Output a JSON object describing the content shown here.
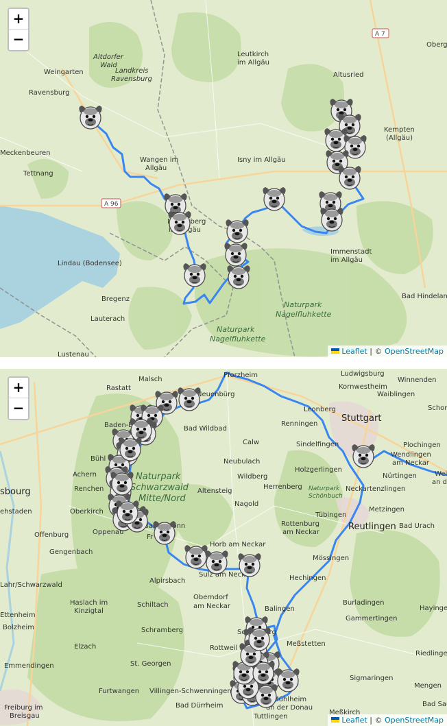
{
  "zoom": {
    "in": "+",
    "out": "−"
  },
  "attribution": {
    "leaflet": "Leaflet",
    "separator": " | © ",
    "osm": "OpenStreetMap"
  },
  "colors": {
    "route": "#3a86f0",
    "water": "#aad3df",
    "forest": "#c3dca6",
    "border": "#8a8a8a"
  },
  "map1": {
    "places": {
      "oberg": "Oberg",
      "altdorfer": "Altdorfer",
      "wald": "Wald",
      "landkreis": "Landkreis",
      "landkreis2": "Ravensburg",
      "weingarten": "Weingarten",
      "leutkirch": "Leutkirch",
      "leutkirch2": "im Allgäu",
      "altusried": "Altusried",
      "ravensburg": "Ravensburg",
      "kempten": "Kempten",
      "kempten2": "(Allgäu)",
      "meckenbeuren": "Meckenbeuren",
      "wangen": "Wangen im",
      "wangen2": "Allgäu",
      "isny": "Isny im Allgäu",
      "tettnang": "Tettnang",
      "lindenberg": "Lindenberg",
      "lindenberg2": "im Allgäu",
      "lindau": "Lindau (Bodensee)",
      "immenstadt": "Immenstadt",
      "immenstadt2": "im Allgäu",
      "bregenz": "Bregenz",
      "lauterach": "Lauterach",
      "badhindelang": "Bad Hindelang",
      "park1": "Naturpark",
      "park1b": "Nagelfluhkette",
      "park2": "Naturpark",
      "park2b": "Nagelfluhkette",
      "lustenau": "Lustenau"
    },
    "roads": {
      "a7": "A 7",
      "a96": "A 96"
    },
    "markers": 16
  },
  "map2": {
    "places": {
      "malsch": "Malsch",
      "pforzheim": "Pforzheim",
      "ludwigsburg": "Ludwigsburg",
      "kornwestheim": "Kornwestheim",
      "winnenden": "Winnenden",
      "rastatt": "Rastatt",
      "neuenburg": "Neuenbürg",
      "waiblingen": "Waiblingen",
      "schorndorf": "Schor",
      "stuttgart": "Stuttgart",
      "leonberg": "Leonberg",
      "renningen": "Renningen",
      "badenbaden": "Baden-Ba",
      "badwildbad": "Bad Wildbad",
      "calw": "Calw",
      "sindelfingen": "Sindelfingen",
      "plochingen": "Plochingen",
      "wendlingen": "Wendlingen",
      "wendlingen2": "am Neckar",
      "buhl": "Bühl",
      "neubulach": "Neubulach",
      "holzgerlingen": "Holzgerlingen",
      "achern": "Achern",
      "wildberg": "Wildberg",
      "nurtingen": "Nürtingen",
      "wei": "Wei",
      "ander": "an de",
      "park": "Naturpark",
      "park2": "Schwarzwald",
      "park3": "Mitte/Nord",
      "renchen": "Renchen",
      "altensteig": "Altensteig",
      "herrenberg": "Herrenberg",
      "schonbuch": "Naturpark",
      "schonbuch2": "Schönbuch",
      "neckartenzlingen": "Neckartenzlingen",
      "sbourg": "sbourg",
      "nagold": "Nagold",
      "metzingen": "Metzingen",
      "stadten": "ehstaden",
      "oberkirch": "Oberkirch",
      "tubingen": "Tübingen",
      "rottenburg": "Rottenburg",
      "rottenburg2": "am Neckar",
      "reutlingen": "Reutlingen",
      "badurach": "Bad Urach",
      "baiersbronn": "Baiersbronn",
      "oppenau": "Oppenau",
      "offenburg": "Offenburg",
      "freudenstadt": "Fr          stadt",
      "horb": "Horb am Neckar",
      "mossingen": "Mössingen",
      "gengenbach": "Gengenbach",
      "alpirsbach": "Alpirsbach",
      "sulz": "Sulz am Neckar",
      "hechingen": "Hechingen",
      "lahr": "Lahr/Schwarzwald",
      "oberndorf": "Oberndorf",
      "oberndorf2": "am Neckar",
      "burladingen": "Burladingen",
      "hausach": "Haslach im",
      "hausach2": "Kinzigtal",
      "schiltach": "Schiltach",
      "balingen": "Balingen",
      "gammertingen": "Gammertingen",
      "hayinge": "Hayinge",
      "ettenheim": "Ettenheim",
      "bolzheim": "Bolzheim",
      "schramberg": "Schramberg",
      "schomberg": "Schömberg",
      "messstetten": "Meßstetten",
      "elzach": "Elzach",
      "rottweil": "Rottweil",
      "riedlinge": "Riedlinge",
      "emmendingen": "Emmendingen",
      "stgeorgen": "St. Georgen",
      "sigmaringen": "Sigmaringen",
      "furtwangen": "Furtwangen",
      "vs": "Villingen-Schwenningen",
      "mengen": "Mengen",
      "freiburg": "Freiburg im",
      "freiburg2": "Breisgau",
      "baddurrheim": "Bad Dürrheim",
      "muhlheim": "Mühlheim",
      "muhlheim2": "an der Donau",
      "badsaul": "Bad Sau",
      "messkirch": "Meßkirch",
      "tuttlingen": "Tuttlingen"
    },
    "markers": 40
  }
}
